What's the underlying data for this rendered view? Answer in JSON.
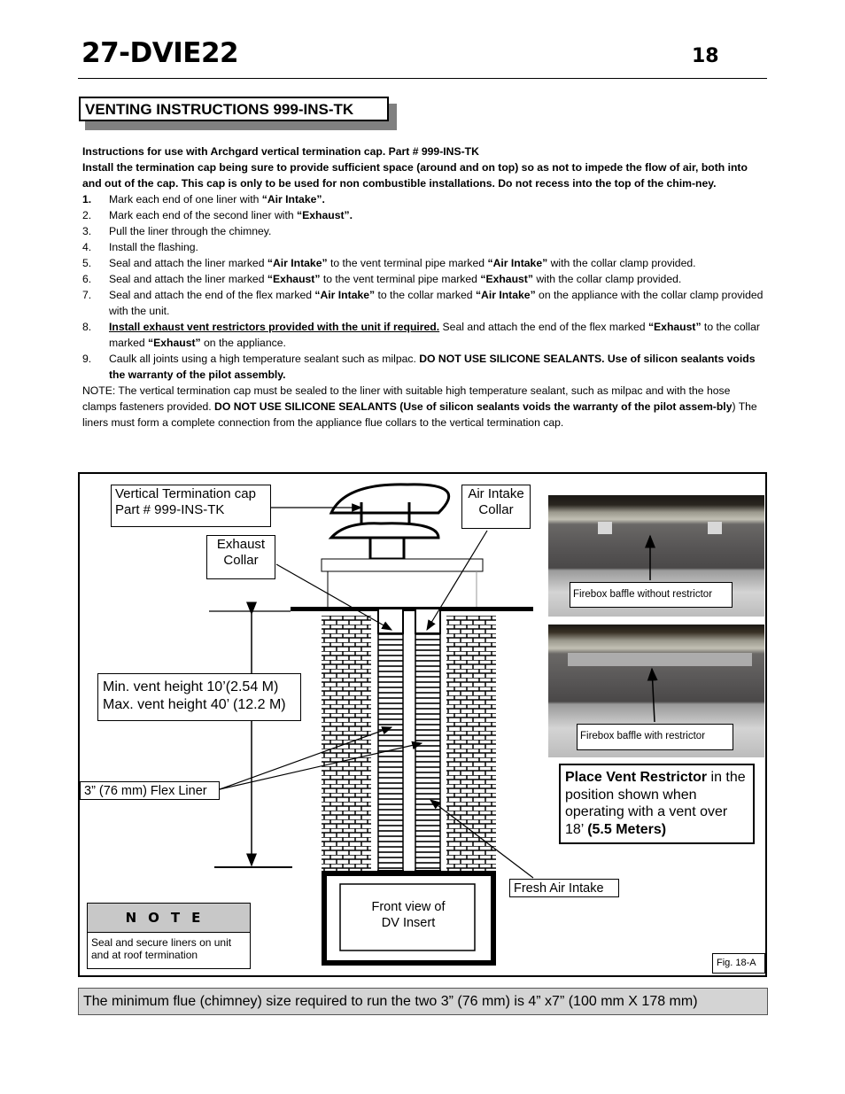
{
  "header": {
    "doc_title": "27-DVIE22",
    "page_number": "18"
  },
  "section": {
    "title": "VENTING INSTRUCTIONS 999-INS-TK"
  },
  "instructions": {
    "intro_line1": "Instructions for use with Archgard vertical termination cap. Part # 999-INS-TK",
    "intro_line2": "Install the termination cap being sure to provide sufficient space (around and on top) so as not to impede the flow of air, both into and out of the cap. This cap is only to be used for non combustible installations. Do not recess into the top of the chim-ney.",
    "steps": [
      {
        "num": "1.",
        "parts": [
          {
            "t": "Mark each end of one liner with "
          },
          {
            "t": "“Air Intake”.",
            "b": true
          }
        ]
      },
      {
        "num": "2.",
        "parts": [
          {
            "t": "Mark each end of the second liner with "
          },
          {
            "t": "“Exhaust”.",
            "b": true
          }
        ]
      },
      {
        "num": "3.",
        "parts": [
          {
            "t": "Pull the liner through the chimney."
          }
        ]
      },
      {
        "num": "4.",
        "parts": [
          {
            "t": "Install the flashing."
          }
        ]
      },
      {
        "num": "5.",
        "parts": [
          {
            "t": "Seal and attach the liner marked "
          },
          {
            "t": "“Air Intake”",
            "b": true
          },
          {
            "t": " to the vent terminal pipe marked "
          },
          {
            "t": "“Air Intake”",
            "b": true
          },
          {
            "t": " with the collar clamp provided."
          }
        ]
      },
      {
        "num": "6.",
        "parts": [
          {
            "t": "Seal and attach the liner marked "
          },
          {
            "t": "“Exhaust”",
            "b": true
          },
          {
            "t": " to the vent terminal pipe marked "
          },
          {
            "t": "“Exhaust”",
            "b": true
          },
          {
            "t": " with the collar clamp provided."
          }
        ]
      },
      {
        "num": "7.",
        "parts": [
          {
            "t": "Seal and attach the end of the flex marked "
          },
          {
            "t": "“Air Intake”",
            "b": true
          },
          {
            "t": "  to the collar marked "
          },
          {
            "t": "“Air Intake”",
            "b": true
          },
          {
            "t": " on the appliance with the collar clamp provided with the unit."
          }
        ]
      },
      {
        "num": "8.",
        "parts": [
          {
            "t": "Install exhaust vent restrictors provided with the unit if required.",
            "b": true,
            "u": true
          },
          {
            "t": "  Seal and attach the end of the flex marked "
          },
          {
            "t": "“Exhaust”",
            "b": true
          },
          {
            "t": " to the collar marked "
          },
          {
            "t": "“Exhaust”",
            "b": true
          },
          {
            "t": " on the appliance."
          }
        ]
      },
      {
        "num": "9.",
        "parts": [
          {
            "t": "Caulk all joints using a high temperature sealant such as milpac.  "
          },
          {
            "t": "DO NOT USE SILICONE SEALANTS.  Use of silicon sealants voids the warranty of the pilot assembly.",
            "b": true
          }
        ]
      }
    ],
    "note_parts": [
      {
        "t": "NOTE: The vertical termination cap must be sealed to the liner with suitable high temperature sealant, such as milpac and with the hose clamps fasteners provided. "
      },
      {
        "t": "DO NOT USE SILICONE SEALANTS (Use of silicon sealants voids the warranty of the pilot assem-bly",
        "b": true
      },
      {
        "t": ")  The liners must form a complete connection from the appliance flue collars to the vertical termination cap."
      }
    ]
  },
  "figure": {
    "callouts": {
      "termination_cap_line1": "Vertical Termination cap",
      "termination_cap_line2": "Part # 999-INS-TK",
      "air_intake_collar_line1": "Air Intake",
      "air_intake_collar_line2": "Collar",
      "exhaust_collar_line1": "Exhaust",
      "exhaust_collar_line2": "Collar",
      "vent_height_line1": "Min. vent height 10’(2.54 M)",
      "vent_height_line2": "Max. vent height 40’ (12.2 M)",
      "flex_liner": "3” (76 mm) Flex Liner",
      "fresh_air_intake": "Fresh Air Intake",
      "dv_insert_line1": "Front view of",
      "dv_insert_line2": "DV Insert",
      "photo1_caption": "Firebox baffle without  restrictor",
      "photo2_caption": "Firebox baffle with restrictor",
      "restrictor_bold": "Place Vent Restrictor",
      "restrictor_text1": " in the position shown when operating with a vent over 18’ ",
      "restrictor_bold2": "(5.5 Meters)",
      "fig_label": "Fig. 18-A"
    },
    "note": {
      "heading": "NOTE",
      "body": "Seal and secure liners on unit and at roof termination"
    }
  },
  "footer_bar": {
    "text": "The minimum flue (chimney) size required to run the two 3” (76 mm) is 4” x7” (100 mm X 178 mm)"
  }
}
